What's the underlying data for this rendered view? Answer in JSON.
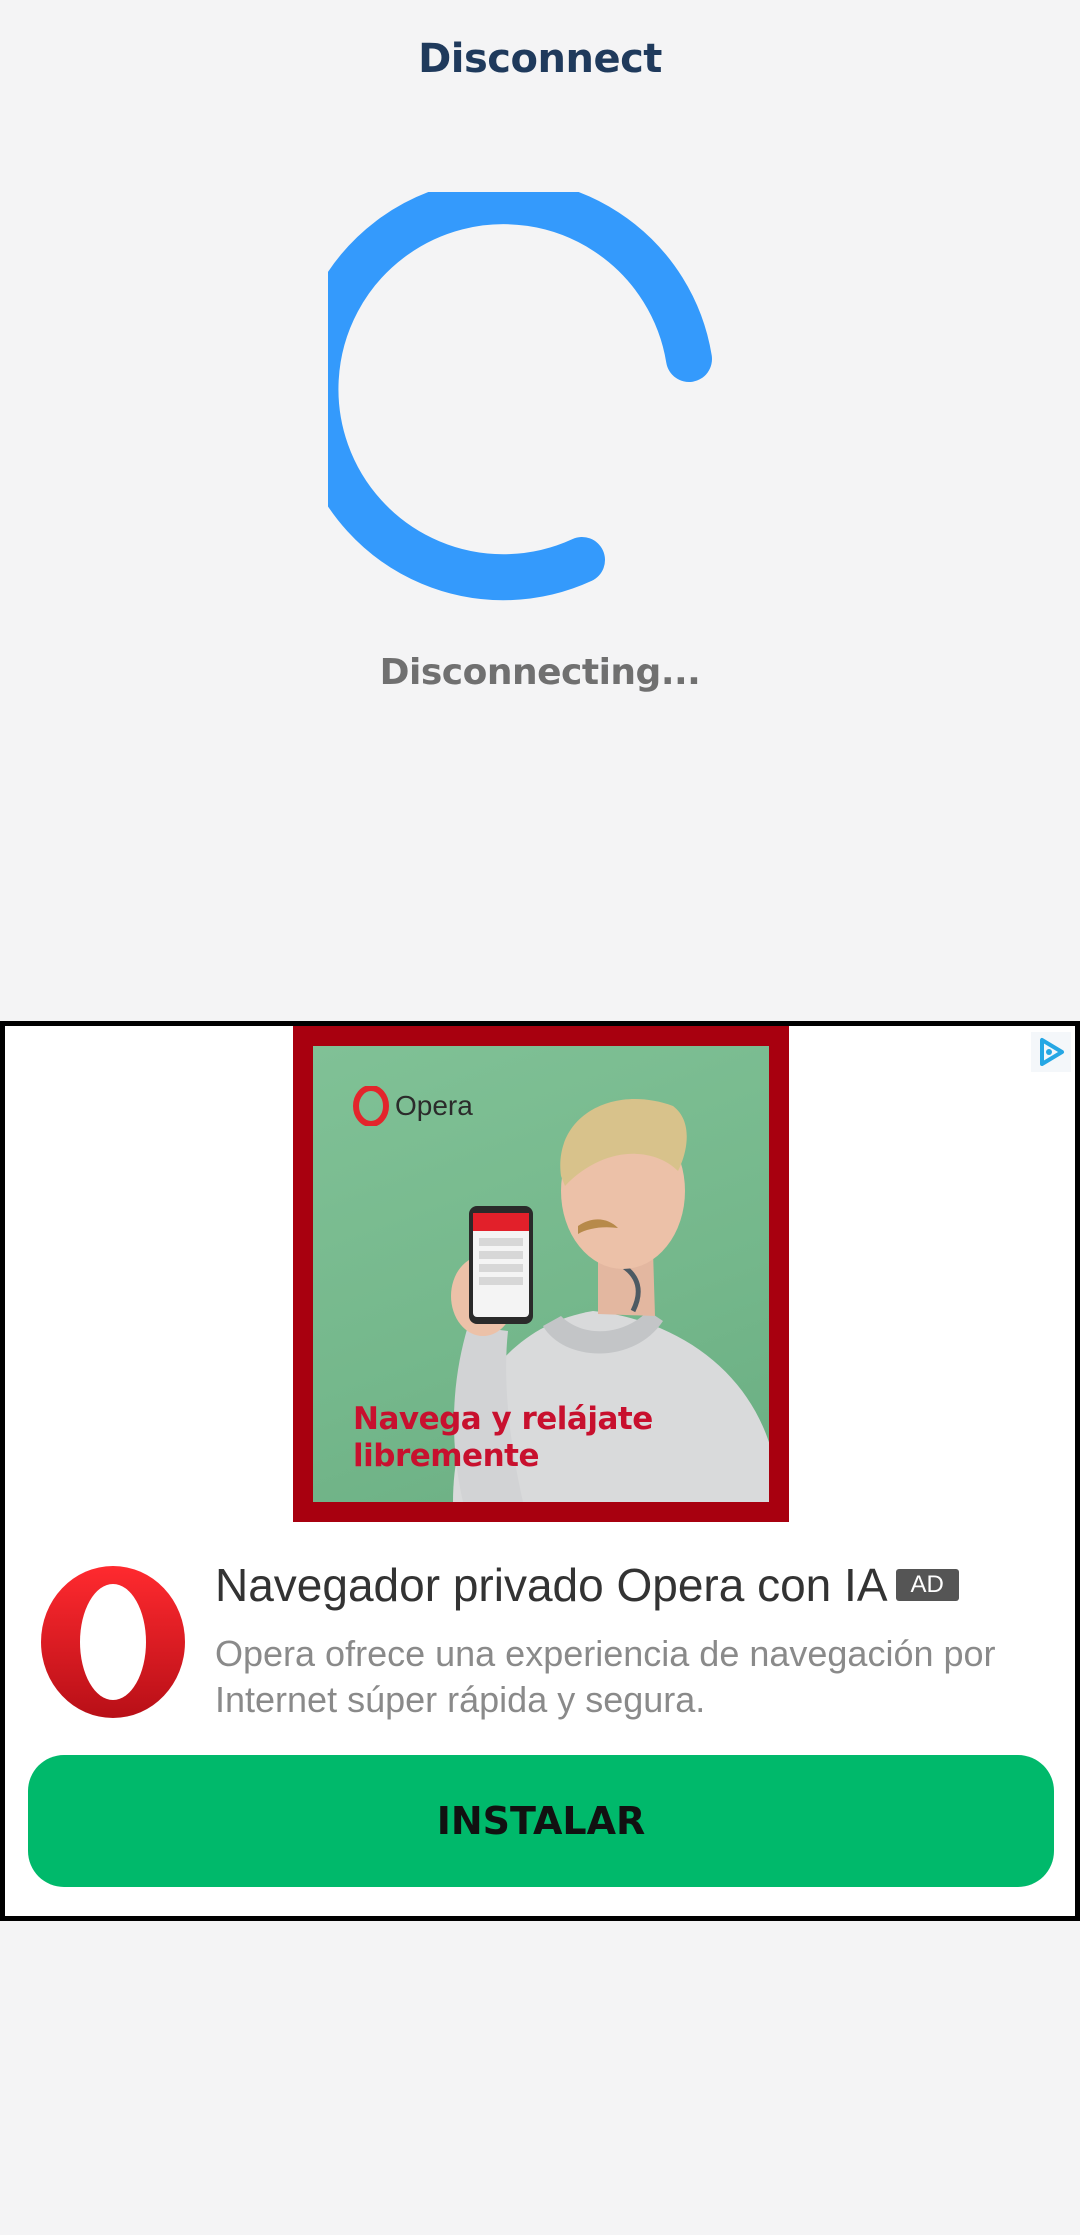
{
  "header": {
    "title": "Disconnect"
  },
  "connection": {
    "status_text": "Disconnecting...",
    "spinner_color": "#349afc"
  },
  "ad": {
    "banner": {
      "brand": "Opera",
      "headline": "Navega y relájate\nlibremente",
      "frame_color": "#a8000f",
      "headline_color": "#c8102e"
    },
    "title": "Navegador privado Opera con IA",
    "badge": "AD",
    "description": "Opera ofrece una experiencia de navegación por Internet súper rápida y segura.",
    "cta_label": "INSTALAR",
    "cta_color": "#00b96b",
    "icons": {
      "ad_choices": "ad-choices-icon",
      "app": "opera-logo-icon"
    }
  }
}
